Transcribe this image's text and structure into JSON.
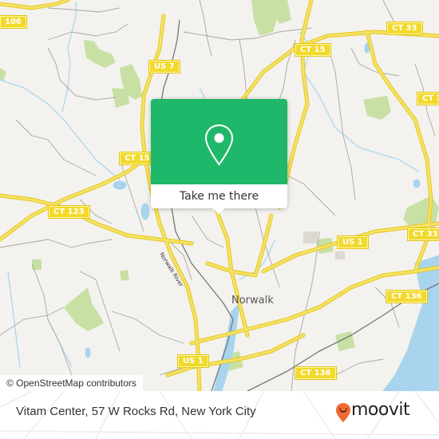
{
  "map": {
    "attribution": "© OpenStreetMap contributors",
    "place_labels": [
      {
        "id": "norwalk",
        "text": "Norwalk"
      }
    ],
    "road_names": [
      {
        "id": "norwalk-river",
        "text": "Norwalk River"
      }
    ],
    "shields": [
      {
        "id": "ct-106",
        "text": "106"
      },
      {
        "id": "us-7",
        "text": "US 7"
      },
      {
        "id": "ct-15-west",
        "text": "CT 15"
      },
      {
        "id": "ct-15-north",
        "text": "CT 15"
      },
      {
        "id": "ct-33-north",
        "text": "CT 33"
      },
      {
        "id": "ct-33-east-top",
        "text": "CT 3"
      },
      {
        "id": "ct-123",
        "text": "CT 123"
      },
      {
        "id": "us-1-east",
        "text": "US 1"
      },
      {
        "id": "ct-33-east",
        "text": "CT 33"
      },
      {
        "id": "ct-136-east",
        "text": "CT 136"
      },
      {
        "id": "us-1-south",
        "text": "US 1"
      },
      {
        "id": "ct-136-south",
        "text": "CT 136"
      }
    ],
    "colors": {
      "land": "#f3f2ee",
      "park": "#c8e0a4",
      "water": "#a8d4ee",
      "highway": "#f2d92a",
      "road": "#a9a6a0",
      "rail": "#777777"
    }
  },
  "popup": {
    "icon": "map-pin-icon",
    "button_label": "Take me there",
    "accent_color": "#1fb86a"
  },
  "footer": {
    "address": "Vitam Center, 57 W Rocks Rd, New York City",
    "brand": "moovit",
    "brand_icon": "moovit-smiley-pin-icon",
    "brand_color": "#f06a32"
  }
}
